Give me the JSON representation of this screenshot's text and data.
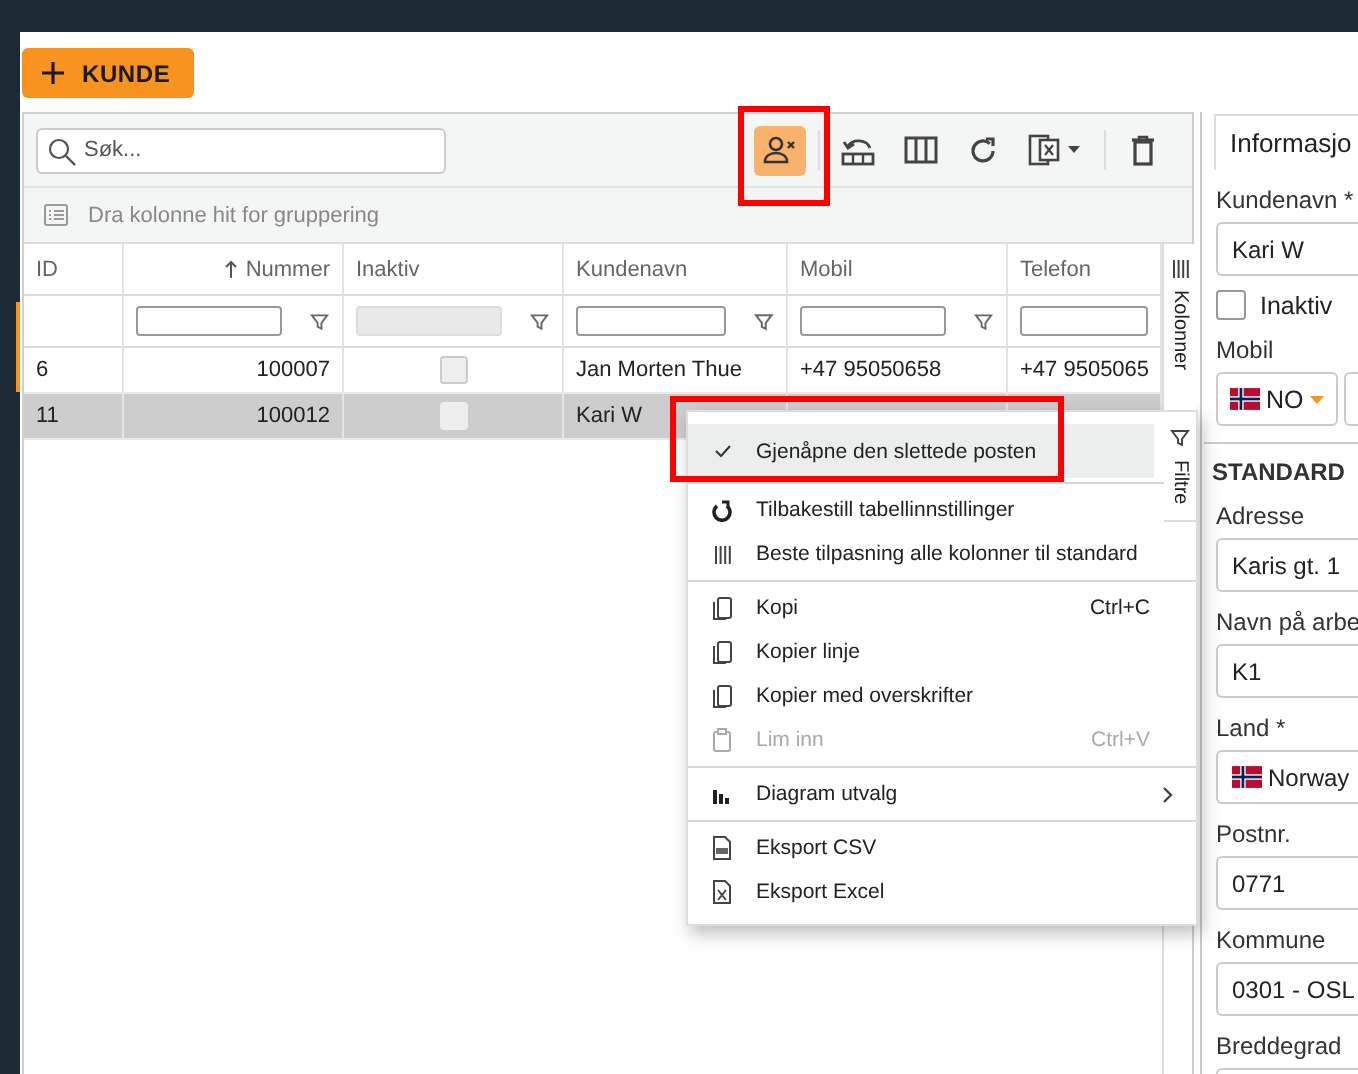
{
  "new_button": {
    "label": "KUNDE"
  },
  "grid": {
    "search": {
      "placeholder": "Søk..."
    },
    "toolbar": [
      {
        "active": true
      },
      {
        "active": false
      },
      {
        "active": false
      },
      {
        "active": false
      },
      {
        "active": false
      },
      {
        "active": false
      }
    ],
    "group_hint": "Dra kolonne hit for gruppering",
    "columns": [
      {
        "label": "ID",
        "sorted": false
      },
      {
        "label": "Nummer",
        "sorted": true,
        "filter": {
          "disabled": false
        }
      },
      {
        "label": "Inaktiv",
        "sorted": false,
        "filter": {
          "disabled": true
        }
      },
      {
        "label": "Kundenavn",
        "sorted": false,
        "filter": {
          "disabled": false
        }
      },
      {
        "label": "Mobil",
        "sorted": false,
        "filter": {
          "disabled": false
        }
      },
      {
        "label": "Telefon",
        "sorted": false,
        "filter": {
          "disabled": false
        }
      }
    ],
    "rows": [
      {
        "selected": false,
        "cells": [
          "6",
          "100007",
          {
            "checked": false
          },
          "Jan Morten Thue",
          "+47 95050658",
          "+47 9505065"
        ]
      },
      {
        "selected": true,
        "cells": [
          "11",
          "100012",
          {
            "checked": false
          },
          "Kari W",
          "",
          ""
        ]
      }
    ],
    "side_tabs": [
      "Kolonner",
      "Filtre"
    ]
  },
  "context_menu": [
    [
      {
        "label": "Gjenåpne den slettede posten",
        "selected": true,
        "disabled": false
      }
    ],
    [
      {
        "label": "Tilbakestill tabellinnstillinger",
        "selected": false,
        "disabled": false
      },
      {
        "label": "Beste tilpasning alle kolonner til standard",
        "selected": false,
        "disabled": false
      }
    ],
    [
      {
        "label": "Kopi",
        "shortcut": "Ctrl+C",
        "selected": false,
        "disabled": false
      },
      {
        "label": "Kopier linje",
        "selected": false,
        "disabled": false
      },
      {
        "label": "Kopier med overskrifter",
        "selected": false,
        "disabled": false
      },
      {
        "label": "Lim inn",
        "shortcut": "Ctrl+V",
        "selected": false,
        "disabled": true
      }
    ],
    [
      {
        "label": "Diagram utvalg",
        "submenu": true,
        "selected": false,
        "disabled": false
      }
    ],
    [
      {
        "label": "Eksport CSV",
        "selected": false,
        "disabled": false
      },
      {
        "label": "Eksport Excel",
        "selected": false,
        "disabled": false
      }
    ]
  ],
  "detail": {
    "tab": "Informasjo",
    "items": [
      {
        "kind": "field",
        "label": "Kundenavn *",
        "value": "Kari W"
      },
      {
        "kind": "checkbox",
        "label": "Inaktiv",
        "checked": false
      },
      {
        "kind": "phone",
        "label": "Mobil",
        "country": "NO"
      },
      {
        "kind": "section",
        "label": "STANDARD"
      },
      {
        "kind": "field",
        "label": "Adresse",
        "value": "Karis gt. 1"
      },
      {
        "kind": "field",
        "label": "Navn på arbe",
        "value": "K1"
      },
      {
        "kind": "country",
        "label": "Land *",
        "value": "Norway"
      },
      {
        "kind": "field",
        "label": "Postnr.",
        "value": "0771"
      },
      {
        "kind": "field",
        "label": "Kommune",
        "value": "0301 - OSL"
      },
      {
        "kind": "field",
        "label": "Breddegrad"
      }
    ]
  }
}
